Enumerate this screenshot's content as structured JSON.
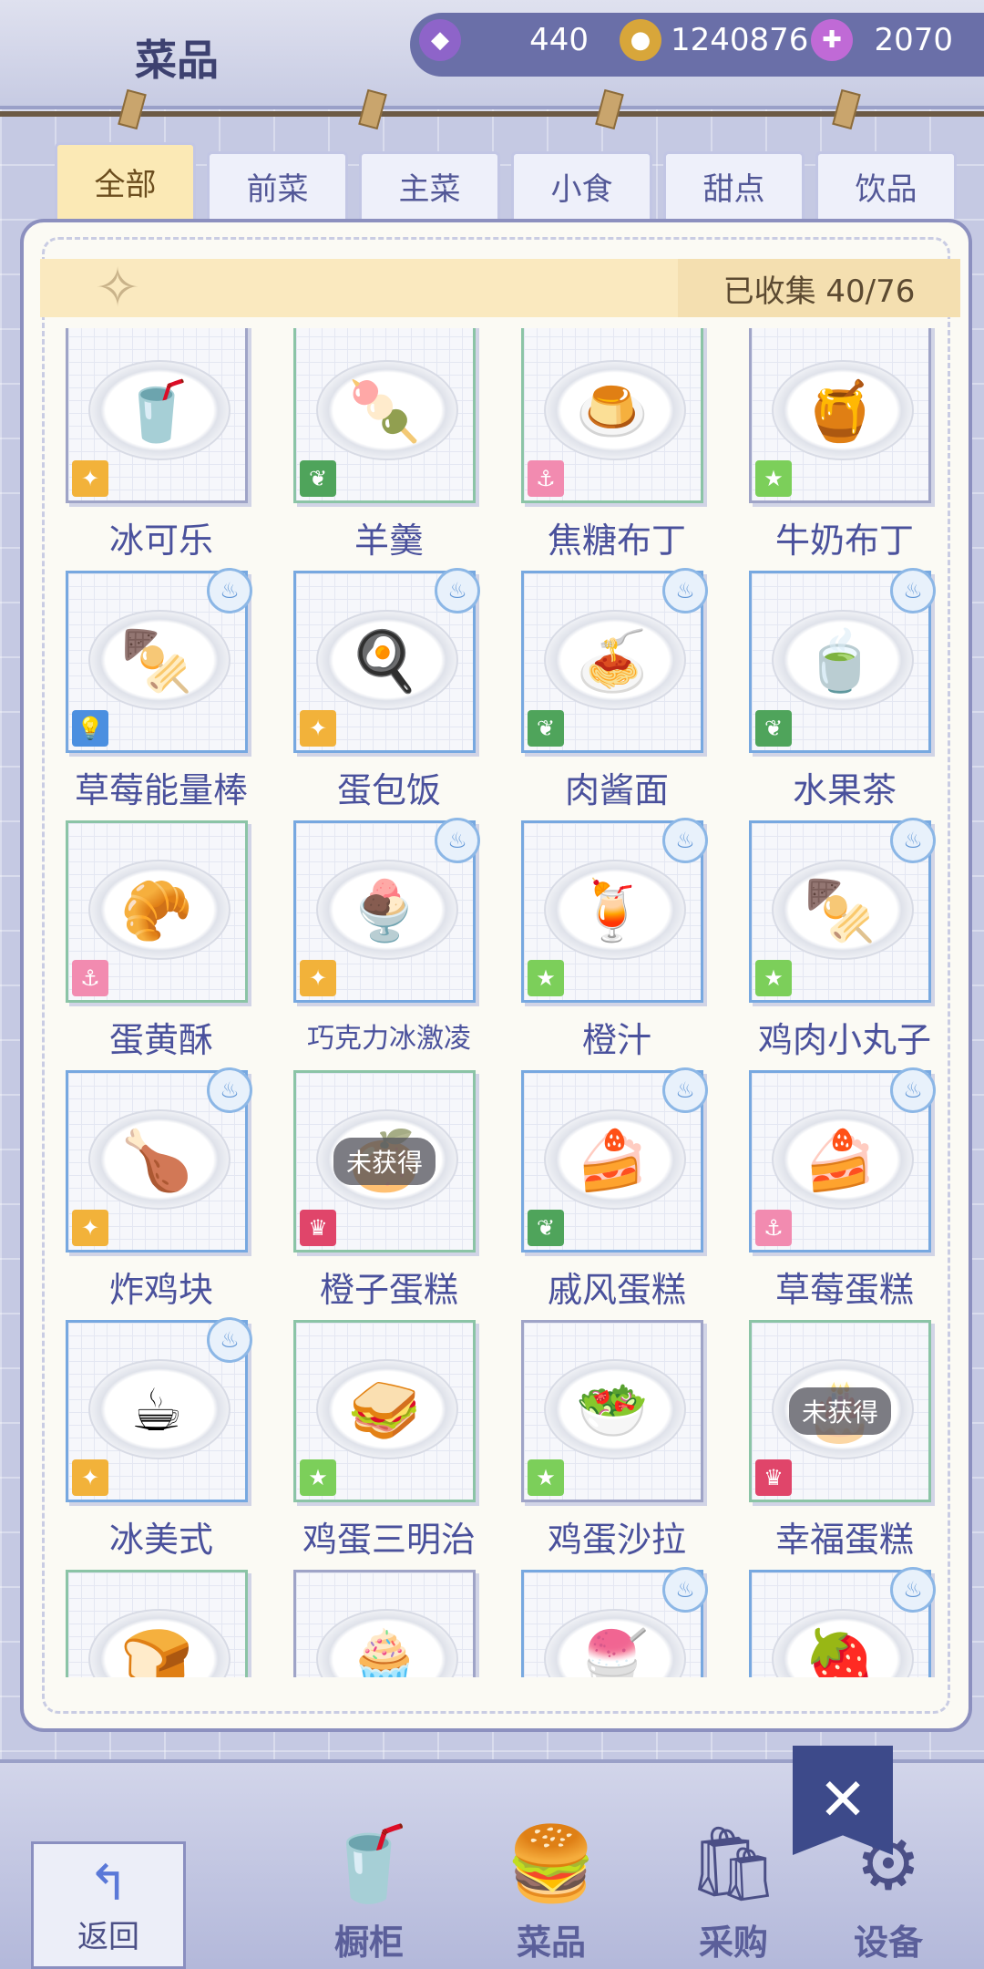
{
  "header": {
    "title": "菜品",
    "currencies": [
      {
        "icon": "gem-icon",
        "value": "440",
        "color": "#8e64c9"
      },
      {
        "icon": "coin-icon",
        "value": "1240876",
        "color": "#d8a63a"
      },
      {
        "icon": "energy-icon",
        "value": "2070",
        "color": "#c06ad6"
      }
    ]
  },
  "tabs": [
    "全部",
    "前菜",
    "主菜",
    "小食",
    "甜点",
    "饮品"
  ],
  "active_tab": "全部",
  "collection": {
    "label": "已收集 40/76"
  },
  "badge_colors": {
    "puzzle": "#f2b23a",
    "leaf": "#4fa45b",
    "anchor": "#f28bb0",
    "star": "#7ccf5a",
    "bulb": "#4b8fe0",
    "crown": "#e0456a"
  },
  "dishes": [
    {
      "name": "冰可乐",
      "badge": "puzzle",
      "pot": false,
      "locked": false,
      "food": "🥤"
    },
    {
      "name": "羊羹",
      "badge": "leaf",
      "pot": false,
      "locked": false,
      "food": "🍡"
    },
    {
      "name": "焦糖布丁",
      "badge": "anchor",
      "pot": false,
      "locked": false,
      "food": "🍮"
    },
    {
      "name": "牛奶布丁",
      "badge": "star",
      "pot": false,
      "locked": false,
      "food": "🍯"
    },
    {
      "name": "草莓能量棒",
      "badge": "bulb",
      "pot": true,
      "locked": false,
      "food": "🍢"
    },
    {
      "name": "蛋包饭",
      "badge": "puzzle",
      "pot": true,
      "locked": false,
      "food": "🍳"
    },
    {
      "name": "肉酱面",
      "badge": "leaf",
      "pot": true,
      "locked": false,
      "food": "🍝"
    },
    {
      "name": "水果茶",
      "badge": "leaf",
      "pot": true,
      "locked": false,
      "food": "🍵"
    },
    {
      "name": "蛋黄酥",
      "badge": "anchor",
      "pot": false,
      "locked": false,
      "food": "🥐"
    },
    {
      "name": "巧克力冰激凌",
      "badge": "puzzle",
      "pot": true,
      "locked": false,
      "food": "🍨"
    },
    {
      "name": "橙汁",
      "badge": "star",
      "pot": true,
      "locked": false,
      "food": "🍹"
    },
    {
      "name": "鸡肉小丸子",
      "badge": "star",
      "pot": true,
      "locked": false,
      "food": "🍢"
    },
    {
      "name": "炸鸡块",
      "badge": "puzzle",
      "pot": true,
      "locked": false,
      "food": "🍗"
    },
    {
      "name": "橙子蛋糕",
      "badge": "crown",
      "pot": false,
      "locked": true,
      "food": "🍊"
    },
    {
      "name": "戚风蛋糕",
      "badge": "leaf",
      "pot": true,
      "locked": false,
      "food": "🍰"
    },
    {
      "name": "草莓蛋糕",
      "badge": "anchor",
      "pot": true,
      "locked": false,
      "food": "🍰"
    },
    {
      "name": "冰美式",
      "badge": "puzzle",
      "pot": true,
      "locked": false,
      "food": "☕"
    },
    {
      "name": "鸡蛋三明治",
      "badge": "star",
      "pot": false,
      "locked": false,
      "food": "🥪"
    },
    {
      "name": "鸡蛋沙拉",
      "badge": "star",
      "pot": false,
      "locked": false,
      "food": "🥗"
    },
    {
      "name": "幸福蛋糕",
      "badge": "crown",
      "pot": false,
      "locked": true,
      "food": "🎂"
    },
    {
      "name": "",
      "badge": "anchor",
      "pot": false,
      "locked": false,
      "food": "🍞"
    },
    {
      "name": "",
      "badge": "puzzle",
      "pot": false,
      "locked": false,
      "food": "🧁"
    },
    {
      "name": "",
      "badge": "star",
      "pot": true,
      "locked": false,
      "food": "🍧"
    },
    {
      "name": "",
      "badge": "puzzle",
      "pot": true,
      "locked": false,
      "food": "🍓"
    }
  ],
  "locked_label": "未获得",
  "bottom_nav": {
    "back": "返回",
    "items": [
      {
        "label": "橱柜",
        "icon": "cabinet-icon",
        "glyph": "🥤"
      },
      {
        "label": "菜品",
        "icon": "burger-icon",
        "glyph": "🍔"
      },
      {
        "label": "采购",
        "icon": "shopping-bag-icon",
        "glyph": "🛍"
      },
      {
        "label": "设备",
        "icon": "coffee-machine-icon",
        "glyph": "⚙"
      }
    ]
  }
}
